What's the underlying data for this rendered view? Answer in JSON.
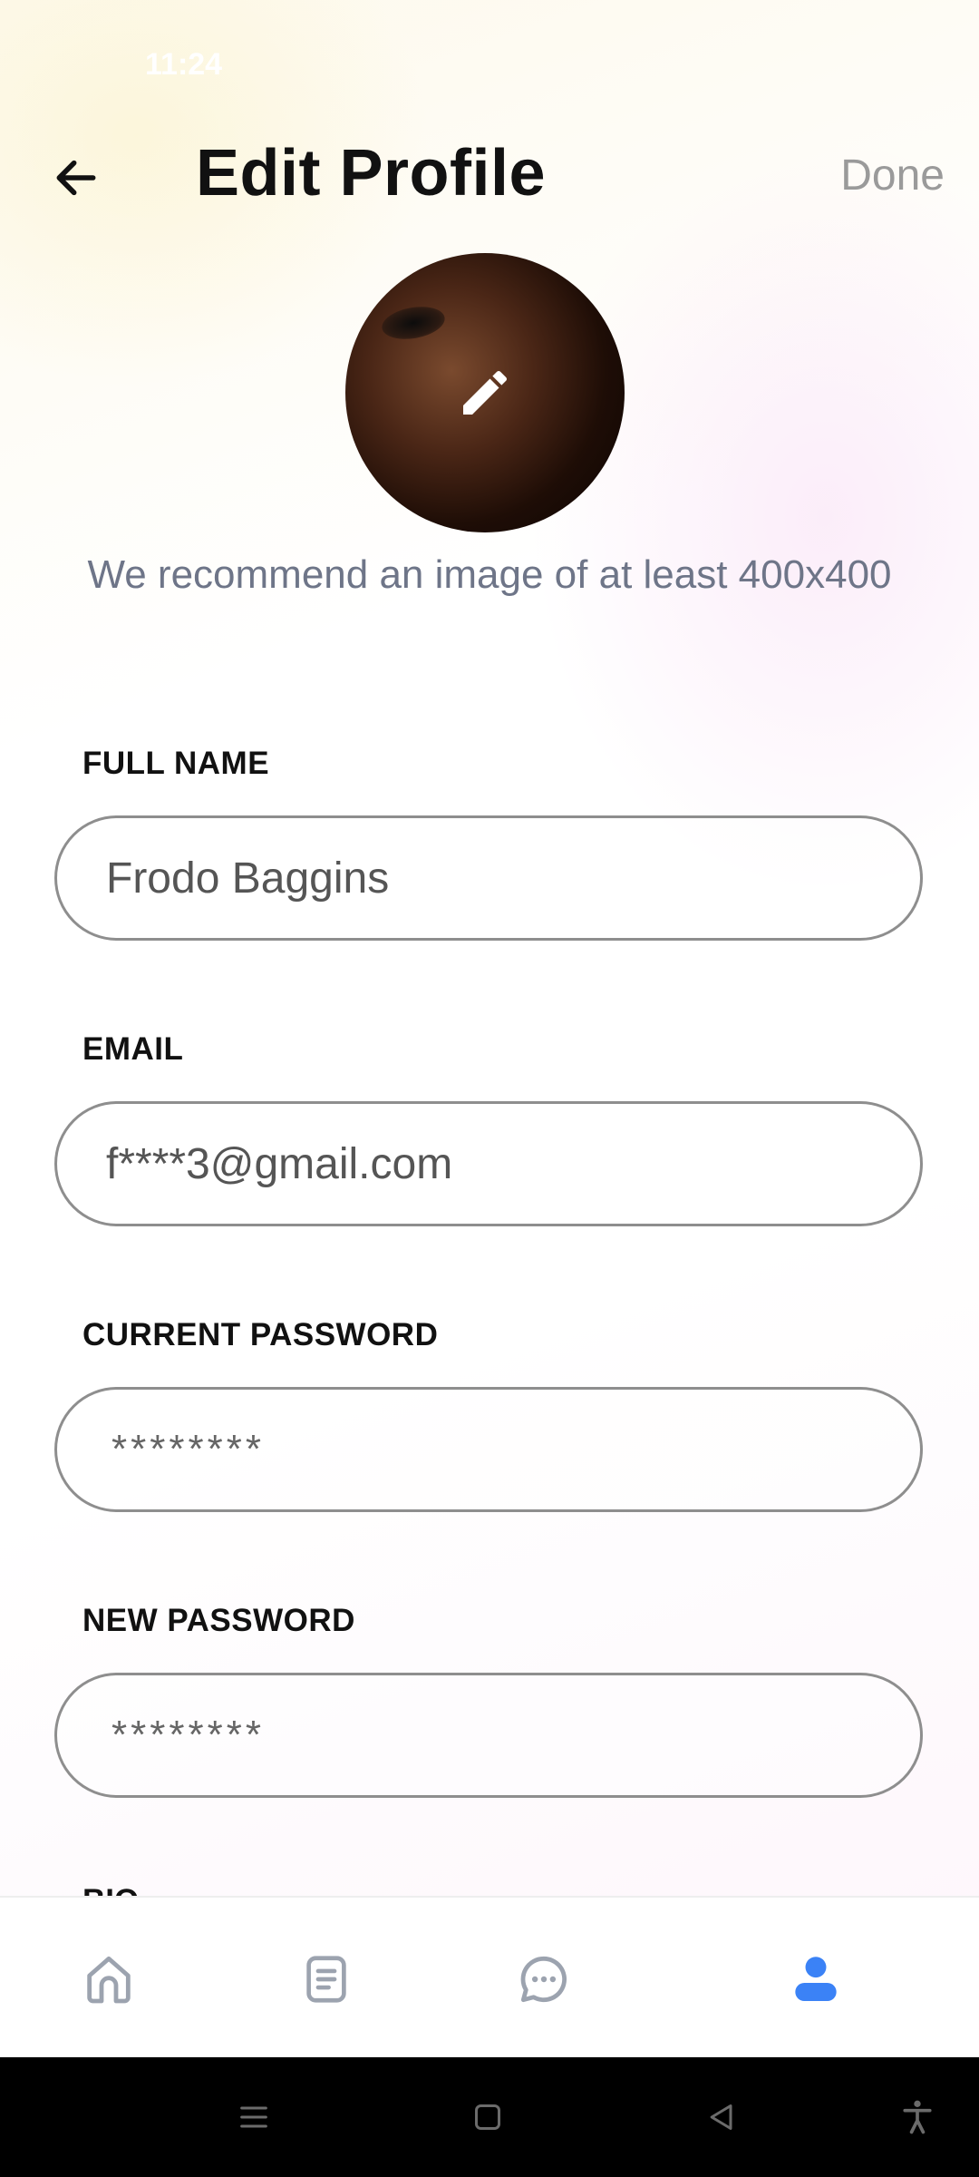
{
  "status_bar": {
    "time": "11:24"
  },
  "header": {
    "title": "Edit Profile",
    "done_label": "Done"
  },
  "avatar": {
    "hint": "We recommend an image of at least 400x400"
  },
  "fields": {
    "full_name": {
      "label": "FULL NAME",
      "value": "Frodo Baggins"
    },
    "email": {
      "label": "EMAIL",
      "value": "f****3@gmail.com"
    },
    "current_password": {
      "label": "CURRENT PASSWORD",
      "value": "********"
    },
    "new_password": {
      "label": "NEW PASSWORD",
      "value": "********"
    },
    "bio": {
      "label": "BIO"
    }
  },
  "bottom_nav": {
    "items": [
      {
        "icon": "home-icon"
      },
      {
        "icon": "document-icon"
      },
      {
        "icon": "chat-icon"
      },
      {
        "icon": "profile-icon",
        "active": true
      }
    ],
    "active_color": "#3b82f6",
    "inactive_color": "#9ca3af"
  },
  "system_nav": {
    "items": [
      "menu-icon",
      "home-square-icon",
      "back-triangle-icon",
      "accessibility-icon"
    ]
  }
}
